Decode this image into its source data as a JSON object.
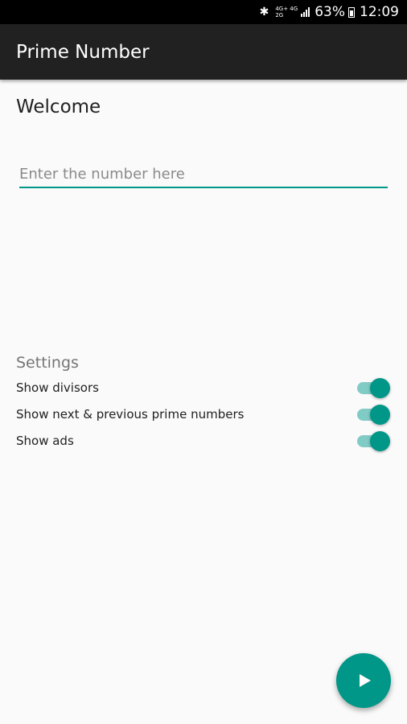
{
  "status_bar": {
    "bluetooth_icon": "bluetooth-icon",
    "network_top": "4G+ 4G",
    "network_bottom": "2G",
    "battery_percent": "63%",
    "time": "12:09"
  },
  "app_bar": {
    "title": "Prime Number"
  },
  "main": {
    "welcome": "Welcome",
    "number_input": {
      "placeholder": "Enter the number here",
      "value": ""
    }
  },
  "settings": {
    "header": "Settings",
    "items": [
      {
        "label": "Show divisors",
        "enabled": true
      },
      {
        "label": "Show next & previous prime numbers",
        "enabled": true
      },
      {
        "label": "Show ads",
        "enabled": true
      }
    ]
  },
  "fab": {
    "icon": "play-icon"
  },
  "colors": {
    "accent": "#009688",
    "accent_light": "#80cbc4",
    "app_bar": "#212121",
    "background": "#fafafa"
  }
}
